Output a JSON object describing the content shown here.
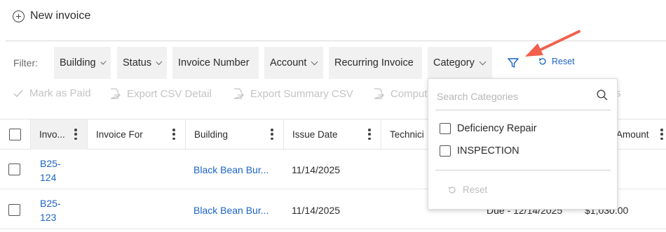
{
  "header": {
    "new_invoice_label": "New invoice"
  },
  "filter_bar": {
    "label": "Filter:",
    "chips": [
      {
        "label": "Building",
        "has_chevron": true
      },
      {
        "label": "Status",
        "has_chevron": true
      },
      {
        "label": "Invoice Number",
        "has_chevron": false
      },
      {
        "label": "Account",
        "has_chevron": true
      },
      {
        "label": "Recurring Invoice",
        "has_chevron": false
      },
      {
        "label": "Category",
        "has_chevron": true
      }
    ],
    "filter_icon": "funnel-icon",
    "reset_label": "Reset"
  },
  "toolbar": {
    "mark_as_paid": "Mark as Paid",
    "export_csv_detail": "Export CSV Detail",
    "export_summary_csv": "Export Summary CSV",
    "compute": "Comput",
    "trailing_partial": "s"
  },
  "table": {
    "columns": [
      "Invo...",
      "Invoice For",
      "Building",
      "Issue Date",
      "Technici",
      "Amount"
    ],
    "rows": [
      {
        "invoice_line1": "B25-",
        "invoice_line2": "124",
        "invoice_for": "",
        "building": "Black Bean Bur...",
        "issue_date": "11/14/2025",
        "due": "",
        "amount": ""
      },
      {
        "invoice_line1": "B25-",
        "invoice_line2": "123",
        "invoice_for": "",
        "building": "Black Bean Bur...",
        "issue_date": "11/14/2025",
        "due": "Due - 12/14/2025",
        "amount": "$1,030.00"
      }
    ]
  },
  "category_dropdown": {
    "search_placeholder": "Search Categories",
    "options": [
      {
        "label": "Deficiency Repair",
        "checked": false
      },
      {
        "label": "INSPECTION",
        "checked": false
      }
    ],
    "reset_label": "Reset"
  },
  "colors": {
    "link": "#1a63c6",
    "annotation_arrow": "#f0604d",
    "chip_bg": "#f1f1f1"
  }
}
